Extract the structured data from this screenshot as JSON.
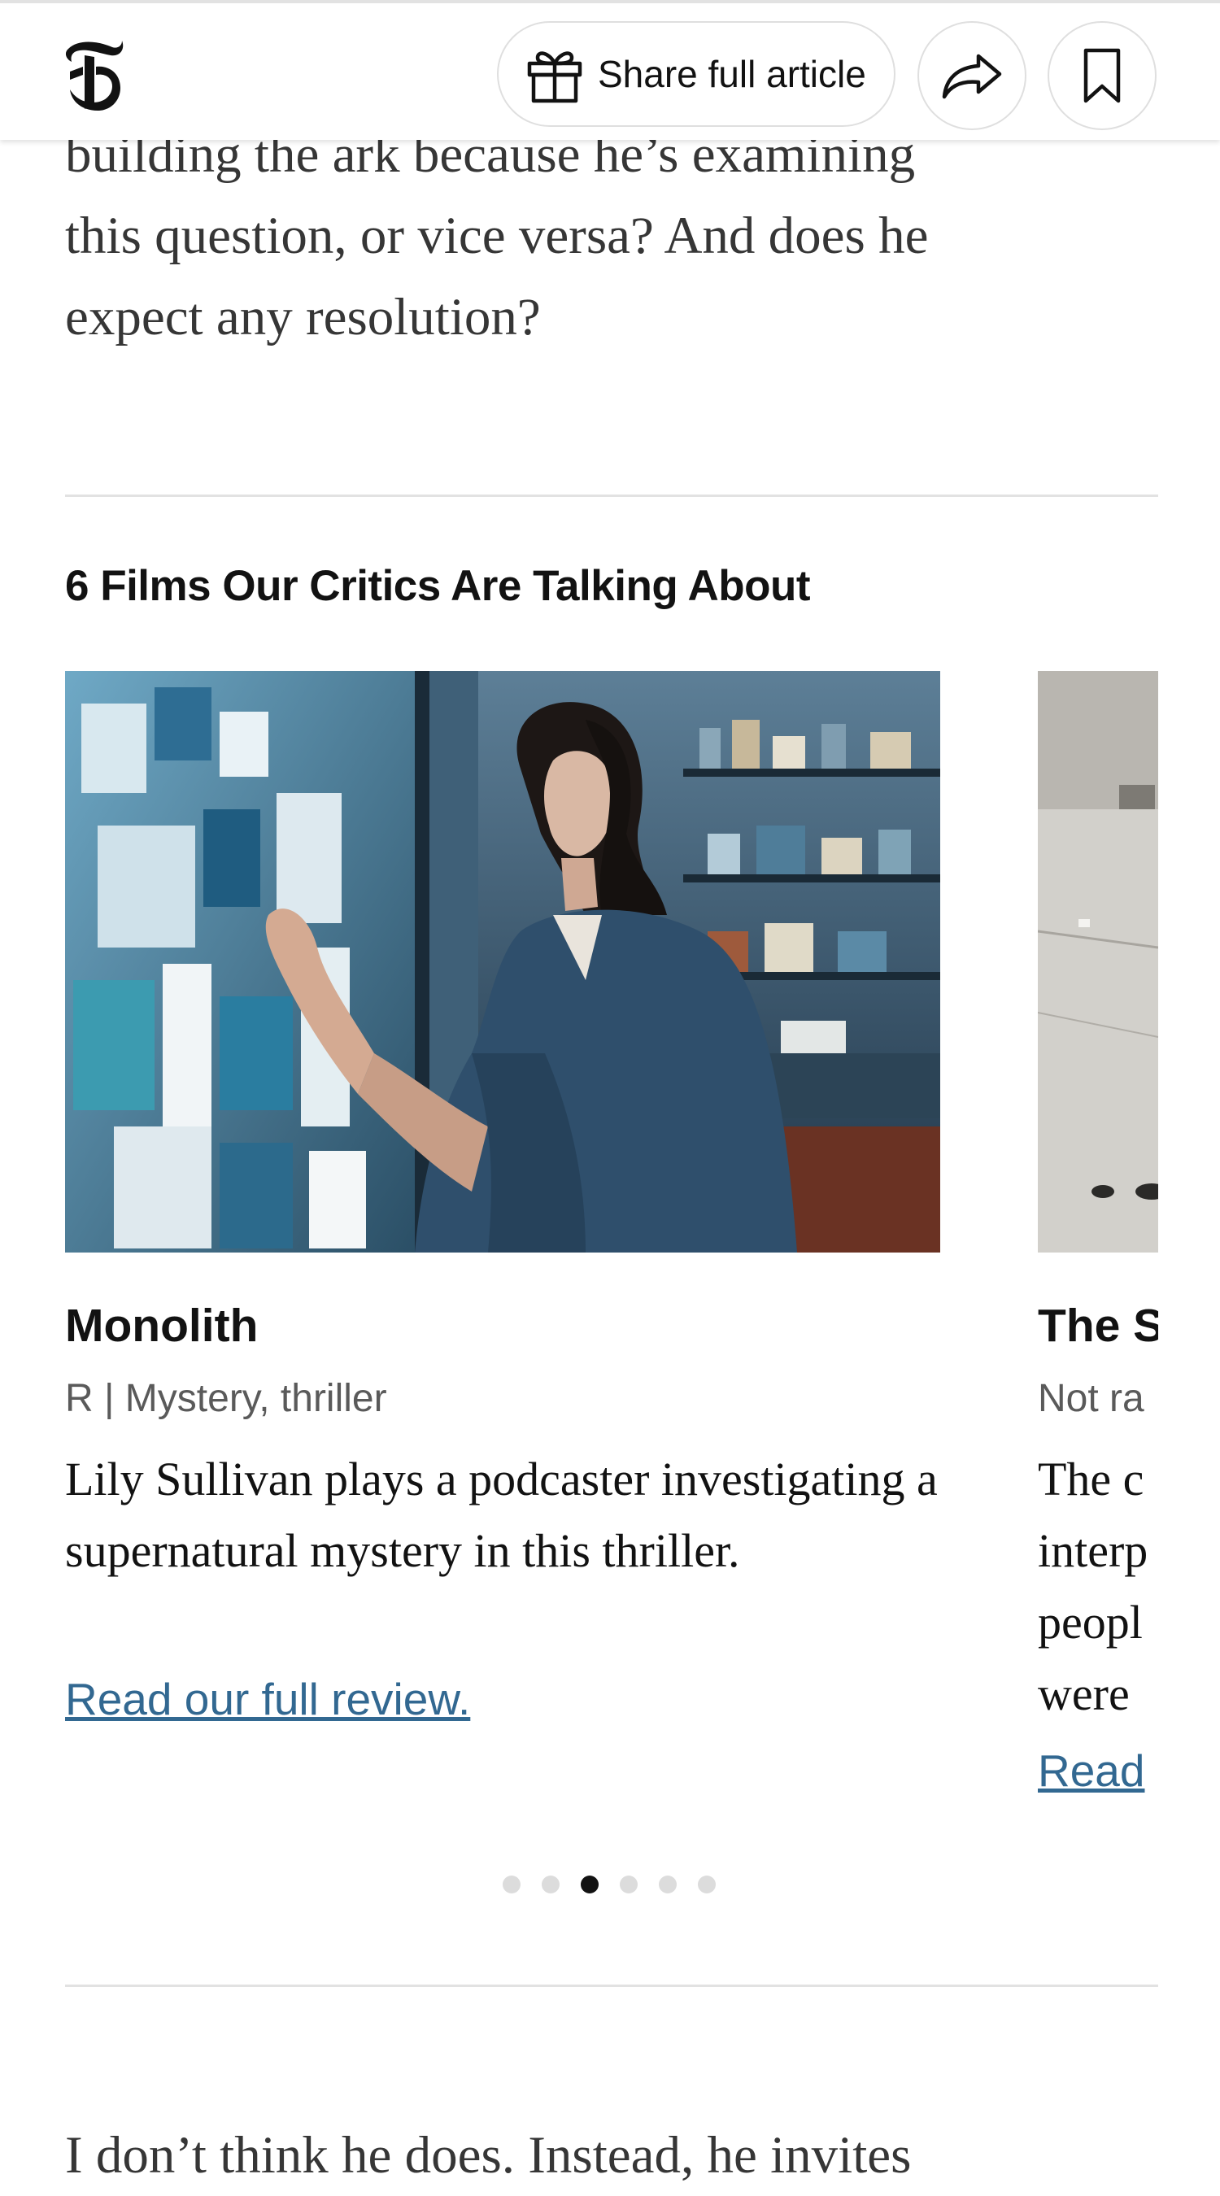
{
  "article": {
    "top_lines": [
      "building the ark because he’s examining",
      "this question, or vice versa? And does he",
      "expect any resolution?"
    ],
    "bottom_line": "I don’t think he does. Instead, he invites"
  },
  "header": {
    "logo_icon": "nyt-t-logo-icon",
    "share_article_label": "Share full article",
    "share_icon": "share-arrow-icon",
    "bookmark_icon": "bookmark-icon"
  },
  "carousel": {
    "title": "6 Films Our Critics Are Talking About",
    "active_index": 2,
    "total_dots": 6,
    "cards": [
      {
        "name": "Monolith",
        "meta": "R | Mystery, thriller",
        "desc": "Lily Sullivan plays a podcaster investigating a supernatural mystery in this thriller.",
        "link": "Read our full review."
      },
      {
        "name": "The S",
        "meta": "Not ra",
        "desc_lines": [
          "The c",
          "interp",
          "peopl",
          "were"
        ],
        "link": "Read"
      }
    ]
  },
  "colors": {
    "link": "#326891",
    "text": "#121212",
    "muted": "#5a5a5a",
    "rule": "#e2e2e2"
  }
}
